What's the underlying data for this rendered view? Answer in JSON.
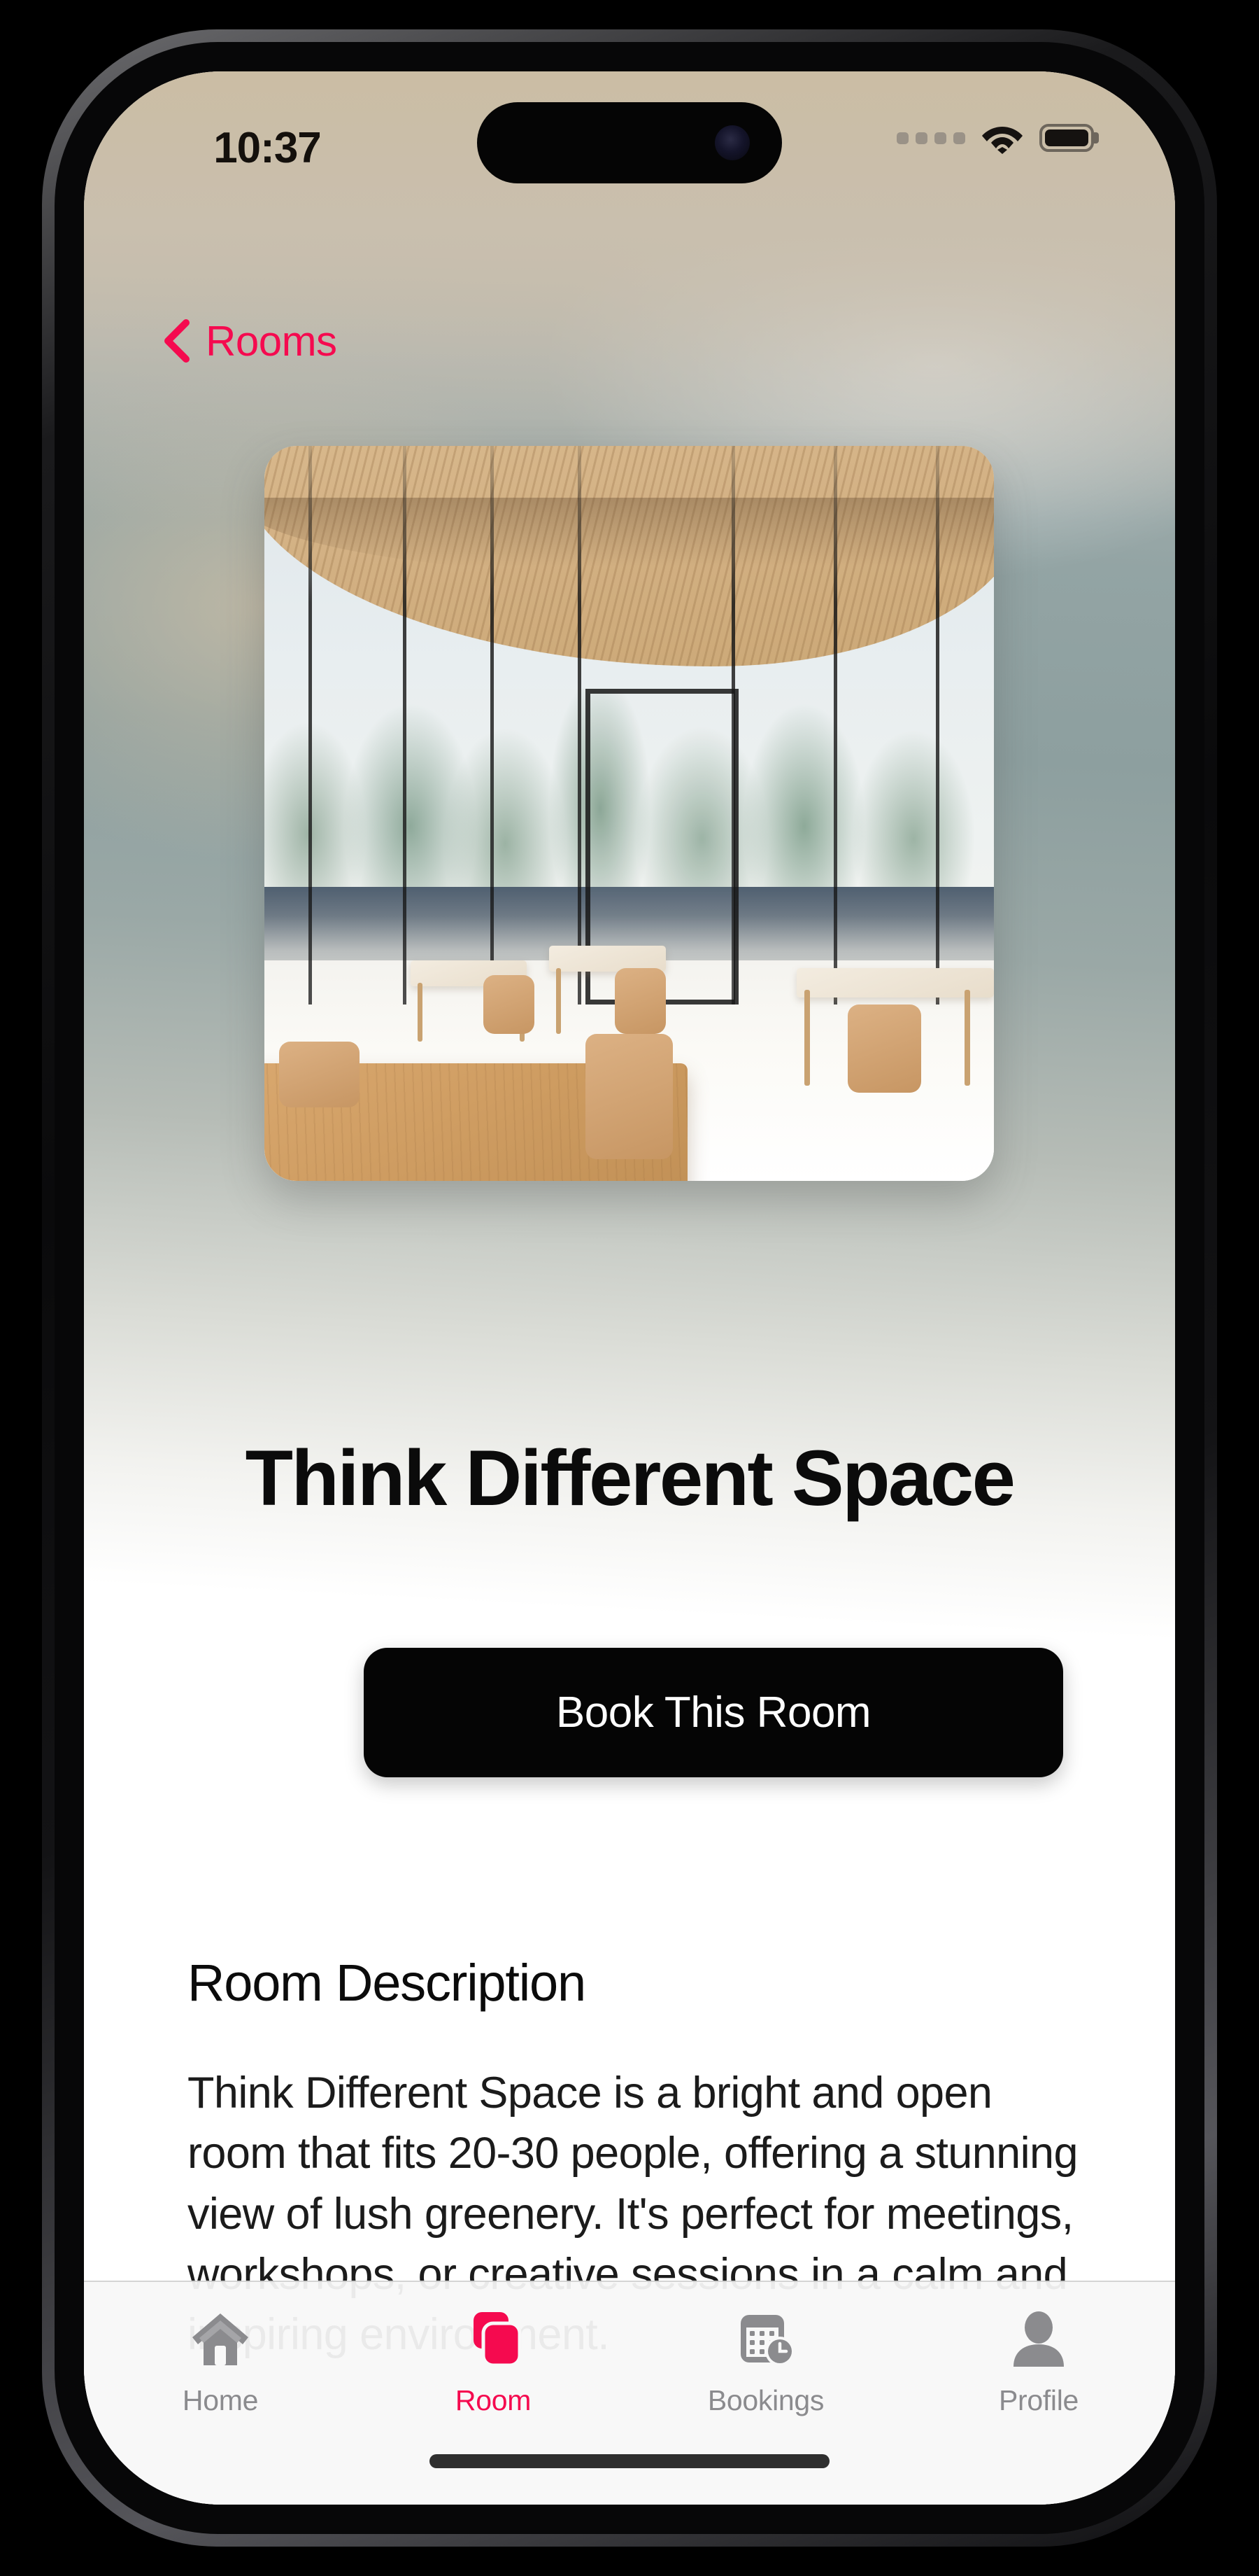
{
  "status_bar": {
    "time": "10:37",
    "cellular_icon": "cellular-dots-icon",
    "wifi_icon": "wifi-icon",
    "battery_icon": "battery-icon"
  },
  "nav": {
    "back_label": "Rooms",
    "back_icon": "chevron-left-icon"
  },
  "room": {
    "image_alt": "room-photo",
    "title": "Think Different Space",
    "book_button_label": "Book This Room",
    "description_heading": "Room Description",
    "description_text": "Think Different Space is a bright and open room that fits 20-30 people, offering a stunning view of lush greenery. It's perfect for meetings, workshops, or creative sessions in a calm and inspiring environment."
  },
  "tab_bar": {
    "items": [
      {
        "label": "Home",
        "icon": "house-icon",
        "active": false
      },
      {
        "label": "Room",
        "icon": "stacked-squares-icon",
        "active": true
      },
      {
        "label": "Bookings",
        "icon": "calendar-clock-icon",
        "active": false
      },
      {
        "label": "Profile",
        "icon": "person-icon",
        "active": false
      }
    ]
  },
  "colors": {
    "accent": "#F50A4F",
    "inactive_tab": "#8B8B8E",
    "button_bg": "#050505",
    "text_primary": "#0B0B0B"
  }
}
